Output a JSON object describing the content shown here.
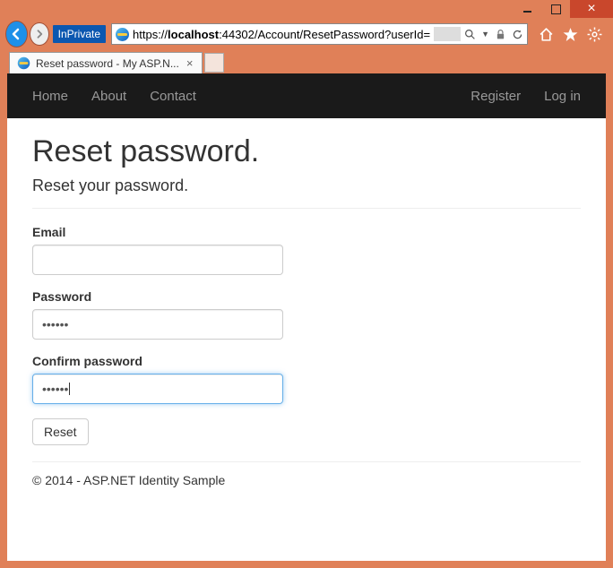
{
  "window": {
    "inprivate_badge": "InPrivate",
    "url_prefix": "https://",
    "url_host": "localhost",
    "url_path": ":44302/Account/ResetPassword?userId=",
    "tab_title": "Reset password - My ASP.N..."
  },
  "navbar": {
    "left": [
      "Home",
      "About",
      "Contact"
    ],
    "right": [
      "Register",
      "Log in"
    ]
  },
  "page": {
    "heading": "Reset password.",
    "subtitle": "Reset your password.",
    "labels": {
      "email": "Email",
      "password": "Password",
      "confirm": "Confirm password"
    },
    "values": {
      "email": "",
      "password": "••••••",
      "confirm": "••••••"
    },
    "submit": "Reset",
    "footer": "© 2014 - ASP.NET Identity Sample"
  }
}
